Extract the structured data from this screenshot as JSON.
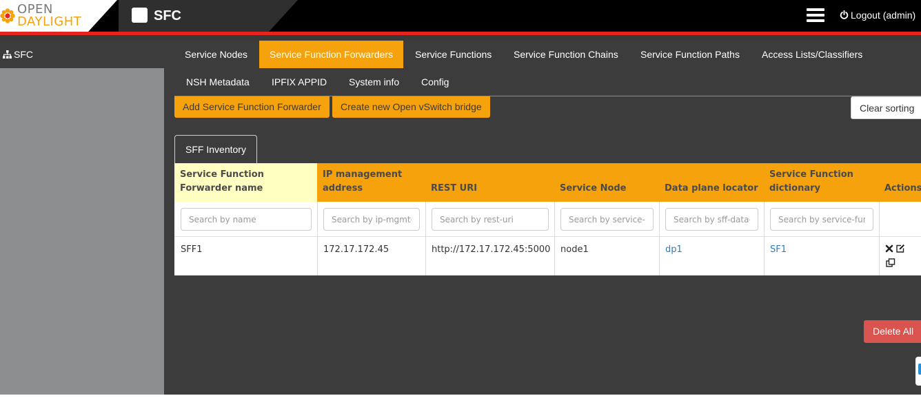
{
  "brand": {
    "logo_line1": "OPEN",
    "logo_line2": "DAYLIGHT",
    "app_title": "SFC"
  },
  "header": {
    "logout_label": "Logout (admin)"
  },
  "sidebar": {
    "root_label": "SFC"
  },
  "tabs": [
    {
      "label": "Service Nodes",
      "active": false
    },
    {
      "label": "Service Function Forwarders",
      "active": true
    },
    {
      "label": "Service Functions",
      "active": false
    },
    {
      "label": "Service Function Chains",
      "active": false
    },
    {
      "label": "Service Function Paths",
      "active": false
    },
    {
      "label": "Access Lists/Classifiers",
      "active": false
    },
    {
      "label": "NSH Metadata",
      "active": false
    },
    {
      "label": "IPFIX APPID",
      "active": false
    },
    {
      "label": "System info",
      "active": false
    },
    {
      "label": "Config",
      "active": false
    }
  ],
  "actions": {
    "add_sff": "Add Service Function Forwarder",
    "create_ovs_bridge": "Create new Open vSwitch bridge",
    "clear_sorting": "Clear sorting",
    "delete_all": "Delete All"
  },
  "inventory": {
    "tab_label": "SFF Inventory",
    "columns": [
      {
        "header": "Service Function Forwarder name",
        "placeholder": "Search by name"
      },
      {
        "header": "IP management address",
        "placeholder": "Search by ip-mgmt-address"
      },
      {
        "header": "REST URI",
        "placeholder": "Search by rest-uri"
      },
      {
        "header": "Service Node",
        "placeholder": "Search by service-node"
      },
      {
        "header": "Data plane locator",
        "placeholder": "Search by sff-data-plane-locator"
      },
      {
        "header": "Service Function dictionary",
        "placeholder": "Search by service-function-dictionary"
      },
      {
        "header": "Actions",
        "placeholder": ""
      }
    ],
    "rows": [
      {
        "name": "SFF1",
        "ip_mgmt": "172.17.172.45",
        "rest_uri": "http://172.17.172.45:5000",
        "service_node": "node1",
        "data_plane_locator": "dp1",
        "sf_dictionary": "SF1"
      }
    ]
  },
  "colors": {
    "accent": "#f5a20c",
    "danger": "#d9534f",
    "topbar": "#000000",
    "redline": "#e5231f",
    "panel": "#3c3c3c",
    "link": "#2a7fb8"
  },
  "icons": [
    "opendaylight-flower-icon",
    "app-square-icon",
    "hamburger-menu-icon",
    "power-icon",
    "sitemap-icon",
    "delete-x-icon",
    "edit-icon",
    "clone-icon"
  ]
}
